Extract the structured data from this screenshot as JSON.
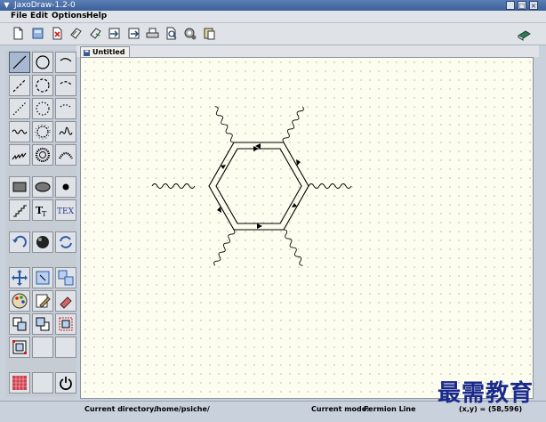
{
  "window": {
    "title": "JaxoDraw-1.2-0"
  },
  "menu": {
    "items": [
      "File",
      "Edit",
      "Options",
      "Help"
    ]
  },
  "toolbar": {
    "buttons": [
      "new-file",
      "open",
      "close",
      "save",
      "save-as",
      "import",
      "export",
      "print",
      "preview",
      "settings",
      "paste"
    ]
  },
  "tab": {
    "label": "Untitled"
  },
  "status": {
    "directory_label": "Current directory:",
    "directory_value": "/home/psiche/",
    "mode_label": "Current mode:",
    "mode_value": "Fermion Line",
    "coords": "(x,y) = (58,596)"
  },
  "watermark": "最需教育",
  "colors": {
    "accent": "#3c5f99",
    "canvas": "#fcfcef",
    "watermark": "#1a2a8c"
  }
}
